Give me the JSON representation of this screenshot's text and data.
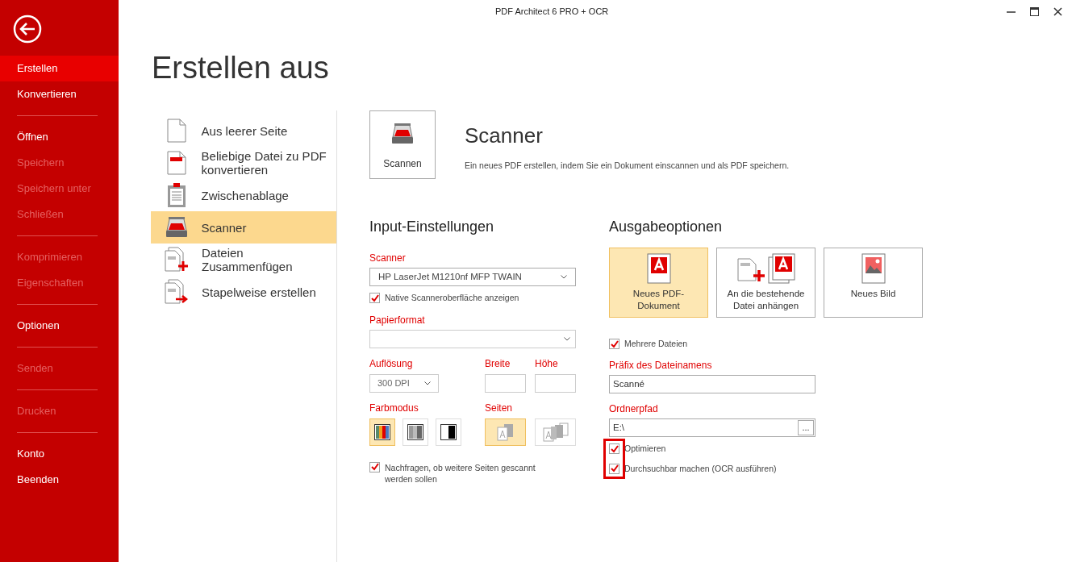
{
  "window": {
    "title": "PDF Architect 6 PRO + OCR"
  },
  "sidebar": {
    "items": [
      {
        "kind": "item",
        "label": "Erstellen",
        "selected": true,
        "disabled": false
      },
      {
        "kind": "item",
        "label": "Konvertieren",
        "selected": false,
        "disabled": false
      },
      {
        "kind": "divider"
      },
      {
        "kind": "item",
        "label": "Öffnen",
        "selected": false,
        "disabled": false
      },
      {
        "kind": "item",
        "label": "Speichern",
        "selected": false,
        "disabled": true
      },
      {
        "kind": "item",
        "label": "Speichern unter",
        "selected": false,
        "disabled": true
      },
      {
        "kind": "item",
        "label": "Schließen",
        "selected": false,
        "disabled": true
      },
      {
        "kind": "divider"
      },
      {
        "kind": "item",
        "label": "Komprimieren",
        "selected": false,
        "disabled": true
      },
      {
        "kind": "item",
        "label": "Eigenschaften",
        "selected": false,
        "disabled": true
      },
      {
        "kind": "divider"
      },
      {
        "kind": "item",
        "label": "Optionen",
        "selected": false,
        "disabled": false
      },
      {
        "kind": "divider"
      },
      {
        "kind": "item",
        "label": "Senden",
        "selected": false,
        "disabled": true
      },
      {
        "kind": "divider"
      },
      {
        "kind": "item",
        "label": "Drucken",
        "selected": false,
        "disabled": true
      },
      {
        "kind": "divider"
      },
      {
        "kind": "item",
        "label": "Konto",
        "selected": false,
        "disabled": false
      },
      {
        "kind": "item",
        "label": "Beenden",
        "selected": false,
        "disabled": false
      }
    ]
  },
  "page_title": "Erstellen aus",
  "sources": [
    {
      "kind": "blank",
      "label": "Aus leerer Seite",
      "selected": false
    },
    {
      "kind": "convert",
      "label": "Beliebige Datei zu PDF konvertieren",
      "selected": false
    },
    {
      "kind": "clipboard",
      "label": "Zwischenablage",
      "selected": false
    },
    {
      "kind": "scanner",
      "label": "Scanner",
      "selected": true
    },
    {
      "kind": "merge",
      "label": "Dateien Zusammenfügen",
      "selected": false
    },
    {
      "kind": "batch",
      "label": "Stapelweise erstellen",
      "selected": false
    }
  ],
  "action": {
    "button": "Scannen",
    "title": "Scanner",
    "description": "Ein neues PDF erstellen, indem Sie ein Dokument einscannen und als PDF speichern."
  },
  "input_settings": {
    "heading": "Input-Einstellungen",
    "scanner_label": "Scanner",
    "scanner_value": "HP LaserJet M1210nf MFP TWAIN",
    "native_ui": {
      "label": "Native Scanneroberfläche anzeigen",
      "checked": true
    },
    "paper_label": "Papierformat",
    "resolution_label": "Auflösung",
    "resolution_value": "300 DPI",
    "width_label": "Breite",
    "height_label": "Höhe",
    "color_label": "Farbmodus",
    "color_modes": [
      {
        "kind": "color",
        "selected": true
      },
      {
        "kind": "gray",
        "selected": false
      },
      {
        "kind": "bw",
        "selected": false
      }
    ],
    "pages_label": "Seiten",
    "page_modes": [
      {
        "kind": "single",
        "selected": true
      },
      {
        "kind": "multi",
        "selected": false
      }
    ],
    "ask_more": {
      "label": "Nachfragen, ob weitere Seiten gescannt werden sollen",
      "checked": true
    }
  },
  "output": {
    "heading": "Ausgabeoptionen",
    "targets": [
      {
        "kind": "new_pdf",
        "label": "Neues PDF-Dokument",
        "selected": true
      },
      {
        "kind": "append",
        "label": "An die bestehende Datei anhängen",
        "selected": false
      },
      {
        "kind": "image",
        "label": "Neues Bild",
        "selected": false
      }
    ],
    "multiple_files": {
      "label": "Mehrere Dateien",
      "checked": true
    },
    "prefix_label": "Präfix des Dateinamens",
    "prefix_value": "Scanné",
    "folder_label": "Ordnerpfad",
    "folder_value": "E:\\",
    "browse": "...",
    "options": [
      {
        "label": "Optimieren",
        "checked": true
      },
      {
        "label": "Durchsuchbar machen (OCR ausführen)",
        "checked": true
      }
    ]
  }
}
